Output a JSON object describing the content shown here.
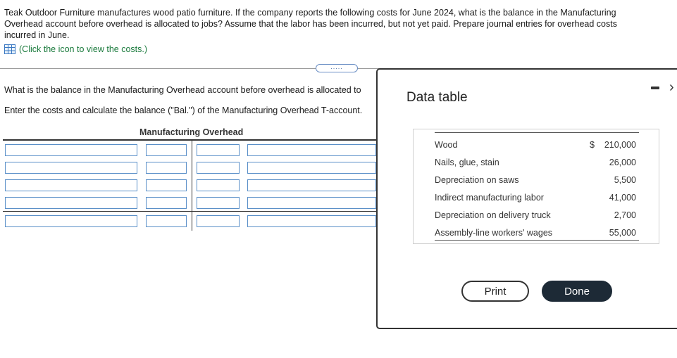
{
  "question": {
    "text": "Teak Outdoor Furniture manufactures wood patio furniture. If the company reports the following costs for June 2024, what is the balance in the Manufacturing Overhead account before overhead is allocated to jobs? Assume that the labor has been incurred, but not yet paid. Prepare journal entries for overhead costs incurred in June.",
    "view_link": "(Click the icon to view the costs.)",
    "expander": "....."
  },
  "task": {
    "line1": "What is the balance in the Manufacturing Overhead account before overhead is allocated to",
    "line2": "Enter the costs and calculate the balance (\"Bal.\") of the Manufacturing Overhead T-account."
  },
  "t_account": {
    "title": "Manufacturing Overhead"
  },
  "modal": {
    "title": "Data table",
    "rows": [
      {
        "label": "Wood",
        "dollar": "$",
        "amount": "210,000"
      },
      {
        "label": "Nails, glue, stain",
        "dollar": "",
        "amount": "26,000"
      },
      {
        "label": "Depreciation on saws",
        "dollar": "",
        "amount": "5,500"
      },
      {
        "label": "Indirect manufacturing labor",
        "dollar": "",
        "amount": "41,000"
      },
      {
        "label": "Depreciation on delivery truck",
        "dollar": "",
        "amount": "2,700"
      },
      {
        "label": "Assembly-line workers' wages",
        "dollar": "",
        "amount": "55,000"
      }
    ],
    "print_label": "Print",
    "done_label": "Done"
  }
}
